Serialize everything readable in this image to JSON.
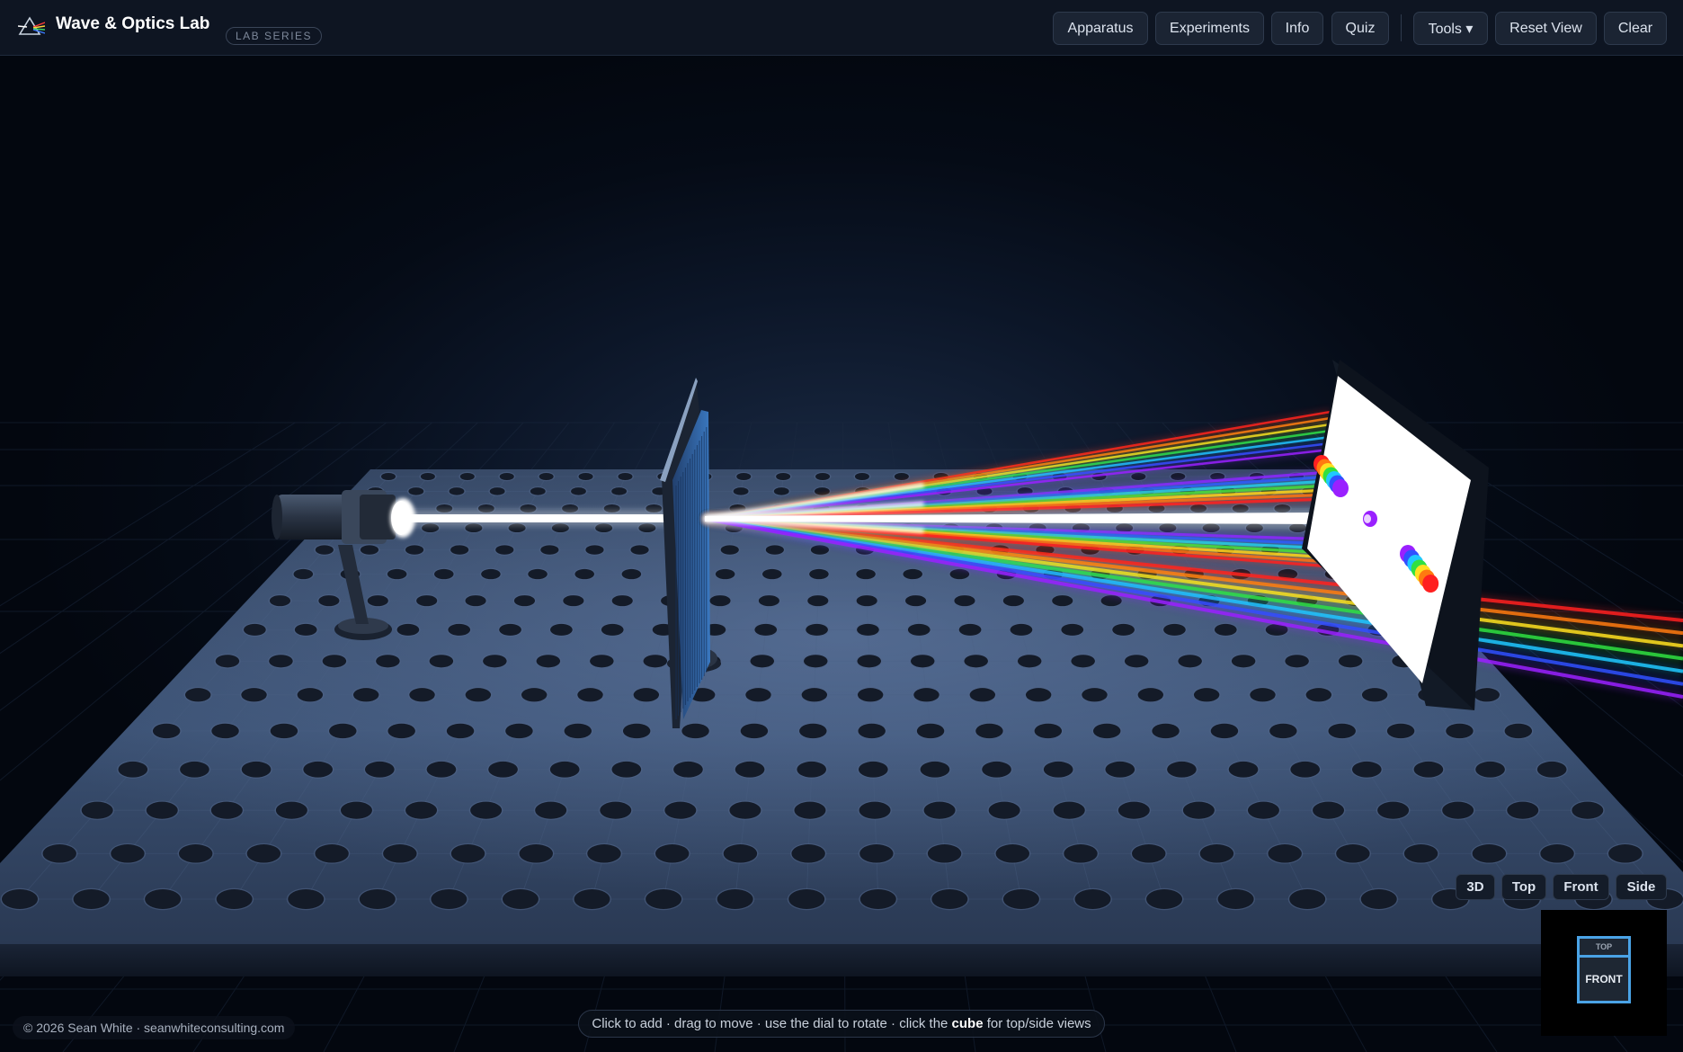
{
  "app": {
    "title": "Wave & Optics Lab",
    "badge": "LAB SERIES"
  },
  "toolbar": {
    "items": [
      {
        "label": "Apparatus"
      },
      {
        "label": "Experiments"
      },
      {
        "label": "Info"
      },
      {
        "label": "Quiz"
      },
      {
        "label": "Tools ▾"
      },
      {
        "label": "Reset View"
      },
      {
        "label": "Clear"
      }
    ]
  },
  "views": {
    "items": [
      {
        "label": "3D"
      },
      {
        "label": "Top"
      },
      {
        "label": "Front"
      },
      {
        "label": "Side"
      }
    ]
  },
  "orientation_cube": {
    "top_label": "TOP",
    "front_label": "FRONT",
    "accent": "#4aa3e6"
  },
  "footer": {
    "copyright": "© 2026 Sean White · seanwhiteconsulting.com"
  },
  "hint": {
    "before": "Click to add · drag to move · use the dial to rotate · click the ",
    "bold": "cube",
    "after": " for top/side views"
  },
  "scene": {
    "objects": [
      "light-source",
      "diffraction-grating",
      "viewing-screen"
    ],
    "spectrum_colors": [
      "#ff2020",
      "#ff7a10",
      "#ffe020",
      "#30e040",
      "#20c8ff",
      "#3050ff",
      "#9a20ff"
    ]
  }
}
